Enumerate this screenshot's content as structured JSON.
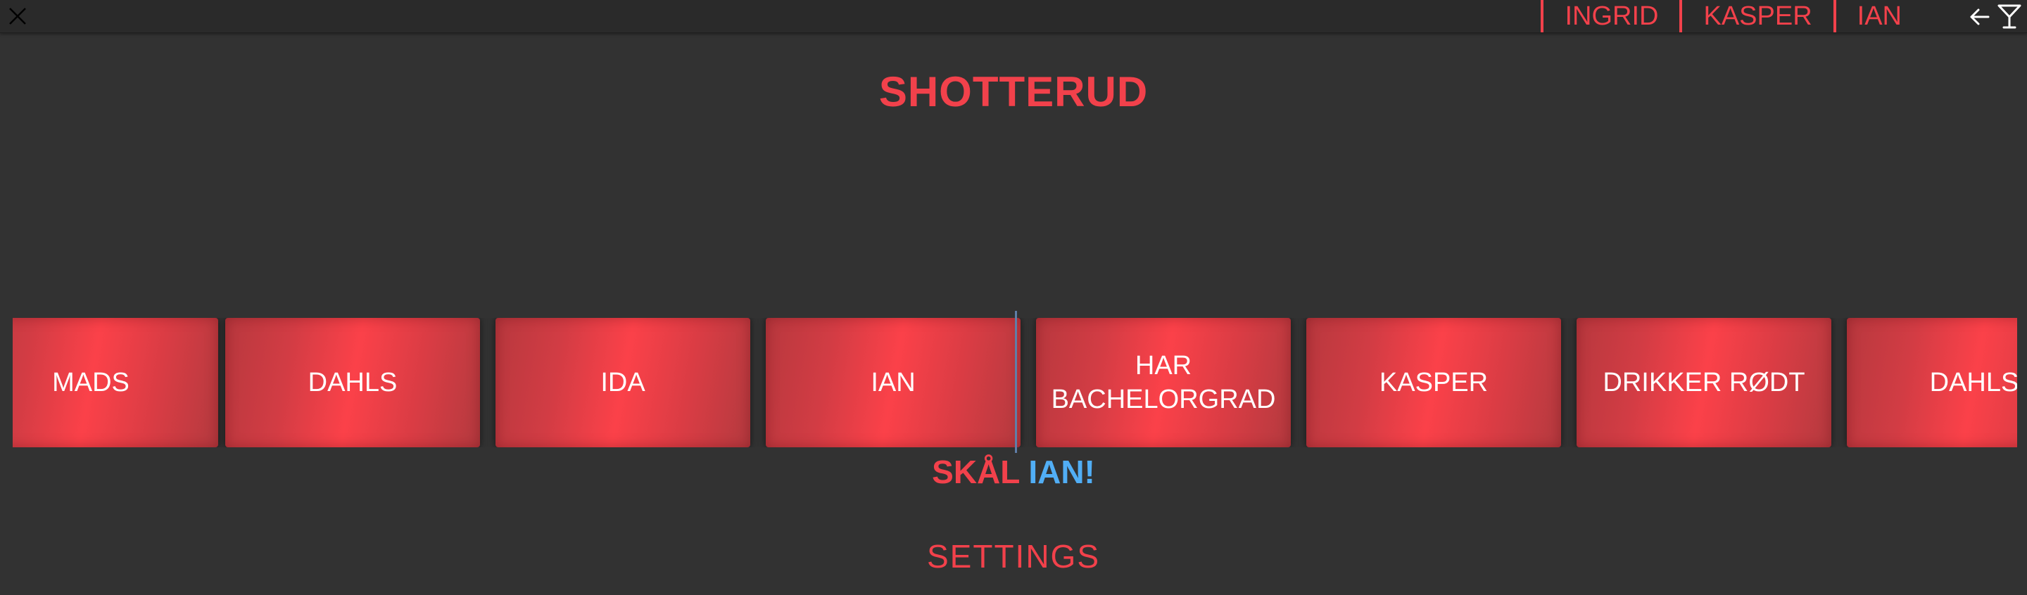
{
  "header": {
    "close_icon": "close-icon",
    "players": [
      "INGRID",
      "KASPER",
      "IAN"
    ],
    "back_icon": "arrow-left-icon",
    "drink_icon": "cocktail-glass-icon"
  },
  "title": "SHOTTERUD",
  "spinner": {
    "cards": [
      "MADS",
      "DAHLS",
      "IDA",
      "IAN",
      "HAR\nBACHELORGRAD",
      "KASPER",
      "DRIKKER RØDT",
      "DAHLS"
    ]
  },
  "result": {
    "word": "SKÅL",
    "name": "IAN!"
  },
  "settings_label": "SETTINGS",
  "colors": {
    "accent": "#f2414b",
    "highlight": "#51aef5",
    "background": "#323232"
  }
}
